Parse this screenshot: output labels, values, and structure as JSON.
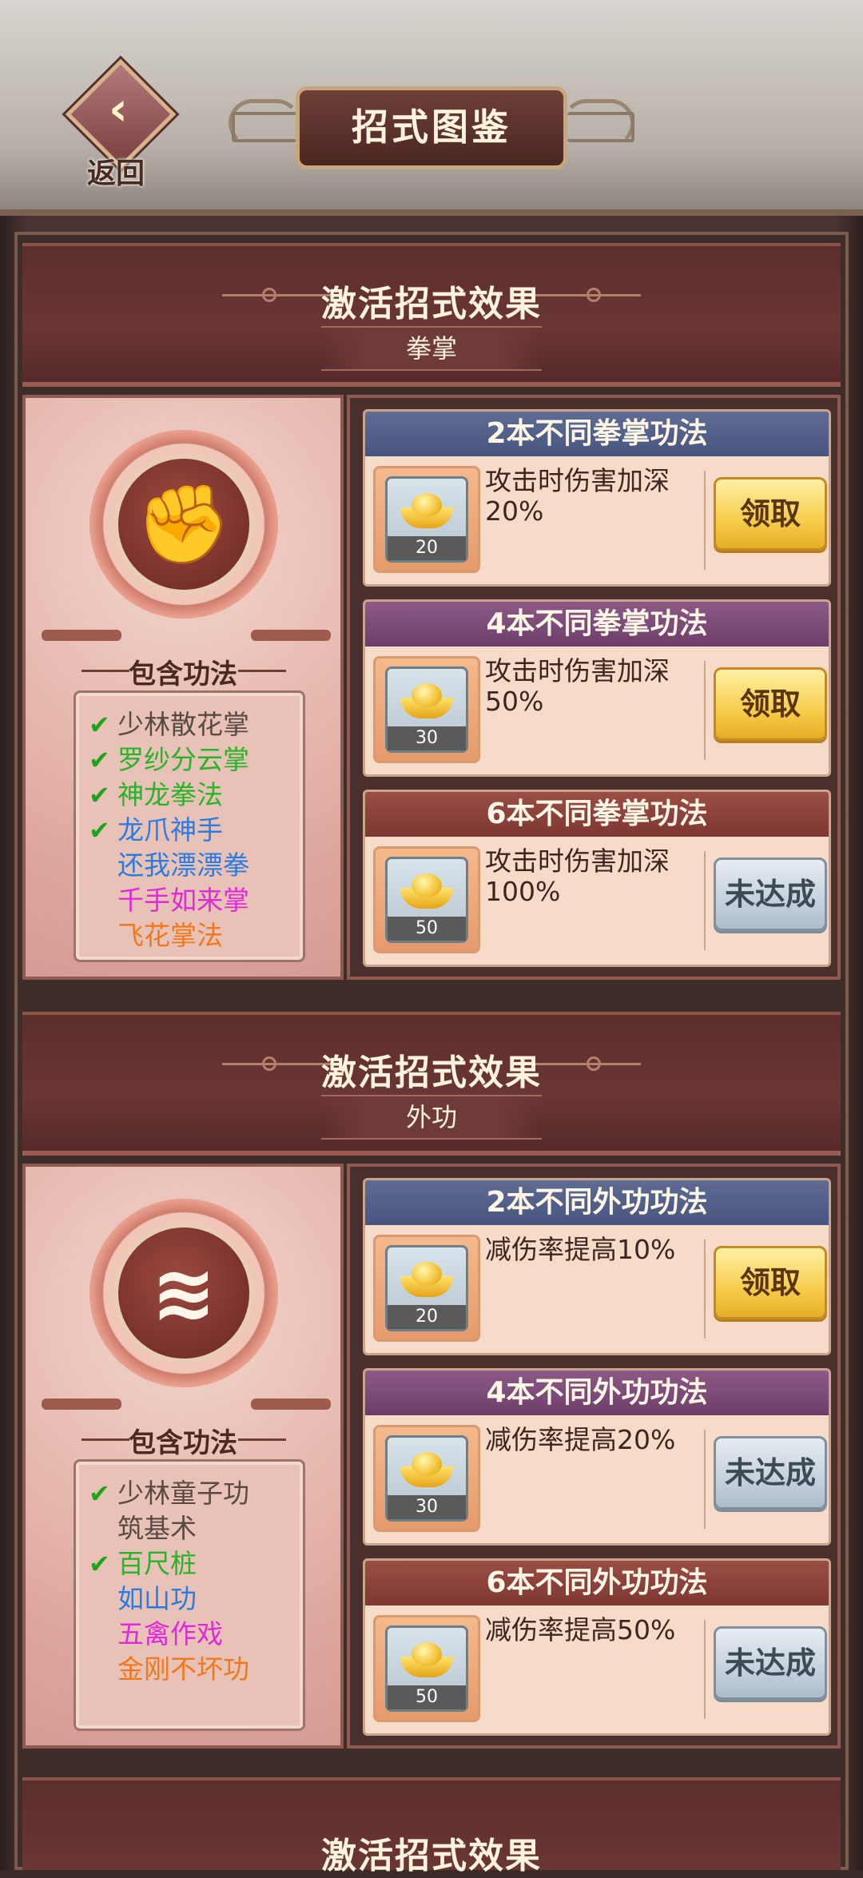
{
  "header": {
    "back_label": "返回",
    "title": "招式图鉴"
  },
  "sections": [
    {
      "title": "激活招式效果",
      "category": "拳掌",
      "emblem_icon": "fist-emblem-icon",
      "contains_label": "包含功法",
      "skills": [
        {
          "name": "少林散花掌",
          "checked": true,
          "color": "#5a4a44"
        },
        {
          "name": "罗纱分云掌",
          "checked": true,
          "color": "#28b428"
        },
        {
          "name": "神龙拳法",
          "checked": true,
          "color": "#28b428"
        },
        {
          "name": "龙爪神手",
          "checked": true,
          "color": "#2b7be0"
        },
        {
          "name": "还我漂漂拳",
          "checked": false,
          "color": "#2b7be0"
        },
        {
          "name": "千手如来掌",
          "checked": false,
          "color": "#e02ad8"
        },
        {
          "name": "飞花掌法",
          "checked": false,
          "color": "#f0781e"
        }
      ],
      "tiers": [
        {
          "header": "2本不同拳掌功法",
          "theme": "blue",
          "reward_count": "20",
          "effect": "攻击时伤害加深20%",
          "button": "领取",
          "state": "claim"
        },
        {
          "header": "4本不同拳掌功法",
          "theme": "purple",
          "reward_count": "30",
          "effect": "攻击时伤害加深50%",
          "button": "领取",
          "state": "claim"
        },
        {
          "header": "6本不同拳掌功法",
          "theme": "red",
          "reward_count": "50",
          "effect": "攻击时伤害加深100%",
          "button": "未达成",
          "state": "locked"
        }
      ]
    },
    {
      "title": "激活招式效果",
      "category": "外功",
      "emblem_icon": "swirl-emblem-icon",
      "contains_label": "包含功法",
      "skills": [
        {
          "name": "少林童子功",
          "checked": true,
          "color": "#5a4a44"
        },
        {
          "name": "筑基术",
          "checked": false,
          "color": "#5a4a44"
        },
        {
          "name": "百尺桩",
          "checked": true,
          "color": "#28b428"
        },
        {
          "name": "如山功",
          "checked": false,
          "color": "#2b7be0"
        },
        {
          "name": "五禽作戏",
          "checked": false,
          "color": "#e02ad8"
        },
        {
          "name": "金刚不坏功",
          "checked": false,
          "color": "#f0781e"
        }
      ],
      "tiers": [
        {
          "header": "2本不同外功功法",
          "theme": "blue",
          "reward_count": "20",
          "effect": "减伤率提高10%",
          "button": "领取",
          "state": "claim"
        },
        {
          "header": "4本不同外功功法",
          "theme": "purple",
          "reward_count": "30",
          "effect": "减伤率提高20%",
          "button": "未达成",
          "state": "locked"
        },
        {
          "header": "6本不同外功功法",
          "theme": "red",
          "reward_count": "50",
          "effect": "减伤率提高50%",
          "button": "未达成",
          "state": "locked"
        }
      ]
    }
  ],
  "next_section_title": "激活招式效果"
}
